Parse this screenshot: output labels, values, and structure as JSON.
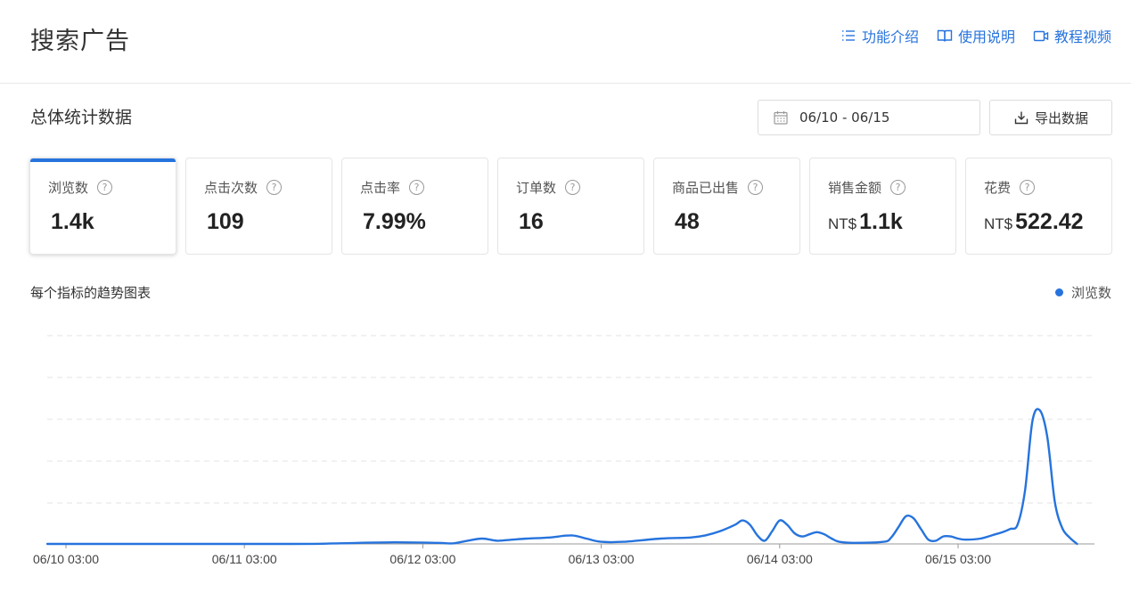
{
  "header": {
    "title": "搜索广告",
    "links": [
      {
        "label": "功能介绍",
        "icon": "list-icon"
      },
      {
        "label": "使用说明",
        "icon": "book-icon"
      },
      {
        "label": "教程视频",
        "icon": "video-icon"
      }
    ]
  },
  "stats": {
    "title": "总体统计数据",
    "date_range": "06/10 - 06/15",
    "export_label": "导出数据",
    "cards": [
      {
        "label": "浏览数",
        "currency": "",
        "value": "1.4k",
        "active": true
      },
      {
        "label": "点击次数",
        "currency": "",
        "value": "109",
        "active": false
      },
      {
        "label": "点击率",
        "currency": "",
        "value": "7.99%",
        "active": false
      },
      {
        "label": "订单数",
        "currency": "",
        "value": "16",
        "active": false
      },
      {
        "label": "商品已出售",
        "currency": "",
        "value": "48",
        "active": false
      },
      {
        "label": "销售金额",
        "currency": "NT$",
        "value": "1.1k",
        "active": false
      },
      {
        "label": "花费",
        "currency": "NT$",
        "value": "522.42",
        "active": false
      }
    ],
    "help_glyph": "?"
  },
  "trend": {
    "title": "每个指标的趋势图表",
    "legend": "浏览数"
  },
  "colors": {
    "accent": "#2673dd",
    "grid": "#e3e3e3"
  },
  "chart_data": {
    "type": "line",
    "x_tick_labels": [
      "06/10 03:00",
      "06/11 03:00",
      "06/12 03:00",
      "06/13 03:00",
      "06/14 03:00",
      "06/15 03:00"
    ],
    "series": [
      {
        "name": "浏览数",
        "x_hours": [
          0,
          4,
          8,
          12,
          16,
          20,
          22,
          24,
          28,
          32,
          36,
          40,
          42,
          46,
          50,
          52,
          54,
          55,
          58,
          62,
          66,
          68,
          69,
          70,
          72,
          74,
          76,
          78,
          82,
          84,
          88,
          90,
          92,
          96,
          98,
          100,
          102,
          104,
          106,
          108,
          112,
          114,
          116,
          120,
          124,
          128,
          132,
          134,
          136,
          138,
          140,
          141,
          142,
          143,
          144,
          145,
          146,
          147,
          148,
          149,
          150,
          151,
          152,
          153,
          154,
          155,
          156,
          157,
          158,
          159,
          160,
          161,
          162,
          163,
          164,
          165,
          166,
          167,
          168,
          169,
          170,
          171,
          172,
          173,
          174,
          175,
          176,
          177,
          178,
          179,
          180,
          181,
          182,
          183,
          184,
          185,
          186,
          187,
          188,
          189,
          190,
          191,
          192,
          193,
          194,
          195,
          196,
          197,
          198,
          199,
          200,
          201,
          202,
          203,
          204,
          205,
          206,
          207,
          208,
          209,
          210,
          211,
          212,
          213,
          214,
          215,
          216,
          217,
          218,
          219,
          220,
          221,
          222,
          223,
          224,
          225,
          226,
          227,
          228,
          229,
          230,
          231,
          232,
          233,
          234,
          235,
          236,
          237,
          238,
          239,
          240,
          241,
          242,
          243,
          244,
          245,
          246,
          247,
          248,
          249,
          250,
          251,
          252,
          253,
          254,
          255,
          256,
          257,
          258,
          259,
          260,
          261,
          262,
          263,
          264,
          265,
          266,
          267,
          268,
          269,
          270,
          271,
          272,
          273,
          274,
          275,
          276,
          277,
          278,
          279,
          280,
          281,
          282
        ],
        "values": [
          0,
          0,
          0,
          0,
          0,
          0,
          0,
          0,
          0,
          0,
          0,
          0,
          0,
          0,
          0,
          0,
          0,
          0,
          0,
          0,
          0,
          0,
          0,
          0,
          0,
          0,
          0,
          0,
          0,
          0,
          0,
          0,
          0,
          0,
          0,
          0,
          0,
          0,
          0,
          0,
          0,
          0,
          0,
          0,
          0,
          0,
          0,
          0,
          0,
          0,
          0,
          0,
          0,
          0,
          0,
          0,
          0,
          0,
          0,
          0,
          0,
          0,
          0,
          0,
          0,
          0,
          0,
          0,
          0,
          0,
          0,
          0,
          0,
          0,
          0,
          0,
          0,
          0,
          0,
          0,
          0,
          0,
          0,
          0,
          0,
          0,
          0,
          0,
          0,
          0,
          0,
          0,
          0,
          0,
          0,
          0,
          0,
          0,
          0,
          0,
          0,
          0,
          0,
          0,
          0,
          0,
          0,
          0,
          0,
          0,
          0,
          0,
          0,
          0,
          0,
          0,
          0,
          0,
          0,
          0,
          0,
          0,
          0,
          0,
          0,
          0,
          0,
          0,
          0,
          0,
          0,
          0,
          0,
          0,
          0,
          0,
          0,
          0,
          0,
          0,
          0,
          0,
          0,
          0,
          0,
          0,
          0,
          0,
          0,
          0,
          0,
          0,
          0,
          0,
          0,
          0,
          0,
          0,
          0,
          0,
          0,
          0,
          0,
          0,
          0,
          0,
          0,
          0,
          0,
          0,
          0,
          0,
          0,
          0,
          0,
          0,
          0,
          0,
          0,
          0,
          0,
          0,
          0,
          0,
          0,
          0,
          0,
          0,
          0,
          0,
          0
        ]
      }
    ],
    "ylim": [
      0,
      250
    ],
    "grid": true,
    "legend_position": "top-right"
  }
}
